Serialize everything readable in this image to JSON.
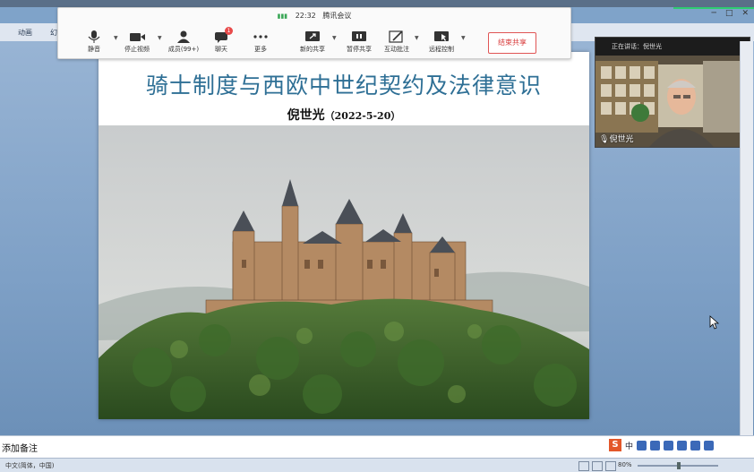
{
  "ppt_menu": {
    "items": [
      "动画",
      "幻"
    ]
  },
  "window_controls": {
    "minimize": "─",
    "restore": "□",
    "close": "✕"
  },
  "meeting": {
    "time": "22:32",
    "app_name": "腾讯会议",
    "toolbar": [
      {
        "key": "mute",
        "label": "静音",
        "icon": "mic-icon",
        "caret": true
      },
      {
        "key": "video",
        "label": "停止视频",
        "icon": "video-camera-icon",
        "caret": true
      },
      {
        "key": "members",
        "label": "成员(99+)",
        "icon": "members-icon",
        "caret": false
      },
      {
        "key": "chat",
        "label": "聊天",
        "icon": "chat-icon",
        "badge": "1"
      },
      {
        "key": "more",
        "label": "更多",
        "icon": "more-dots-icon"
      },
      {
        "key": "new_share",
        "label": "新的共享",
        "icon": "share-screen-icon",
        "caret": true
      },
      {
        "key": "pause_share",
        "label": "暂停共享",
        "icon": "pause-icon"
      },
      {
        "key": "annotate",
        "label": "互动批注",
        "icon": "annotate-icon",
        "caret": true
      },
      {
        "key": "remote",
        "label": "远程控制",
        "icon": "remote-control-icon",
        "caret": true
      }
    ],
    "end_share_label": "结束共享"
  },
  "video_panel": {
    "speaking_label": "正在讲话：倪世光",
    "participant_name": "倪世光"
  },
  "slide": {
    "title": "骑士制度与西欧中世纪契约及法律意识",
    "author": "倪世光",
    "date": "（2022-5-20）"
  },
  "notes": {
    "placeholder_text": "添加备注"
  },
  "ime_bar": {
    "label": "中"
  },
  "status_bar": {
    "language": "中文(简体，中国)",
    "zoom": "80%"
  }
}
